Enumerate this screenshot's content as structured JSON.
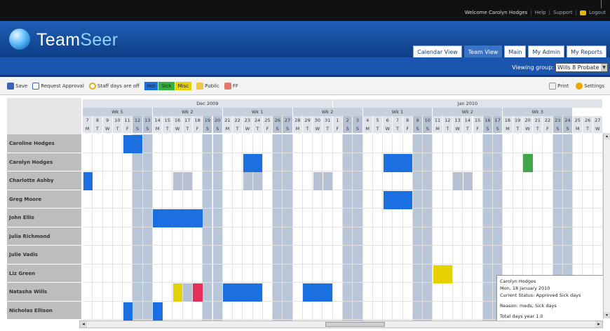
{
  "topbar": {
    "welcome": "Welcome Carolyn Hodges",
    "help": "Help",
    "support": "Support",
    "logout": "Logout",
    "sep": "|"
  },
  "header": {
    "logo_team": "Team",
    "logo_seer": "Seer",
    "tabs": [
      {
        "label": "Calendar View",
        "active": false
      },
      {
        "label": "Team View",
        "active": true
      },
      {
        "label": "Main",
        "active": false
      },
      {
        "label": "My Admin",
        "active": false
      },
      {
        "label": "My Reports",
        "active": false
      }
    ]
  },
  "group": {
    "label": "Viewing group:",
    "value": "Wills 8 Probate"
  },
  "toolbar": {
    "save": "Save",
    "request": "Request Approval",
    "staff": "Staff days are off",
    "legend": [
      {
        "label": "Hol",
        "color": "#1b6fe0"
      },
      {
        "label": "Sick",
        "color": "#36b140"
      },
      {
        "label": "Misc",
        "color": "#e5d000"
      }
    ],
    "public": "Public",
    "ff": "FF",
    "print": "Print",
    "settings": "Settings"
  },
  "calendar": {
    "months": [
      {
        "label": "Dec 2009"
      },
      {
        "label": "Jan 2010"
      }
    ],
    "weeks": [
      "Wk 5",
      "Wk 2",
      "Wk 1",
      "Wk 2",
      "Wk 1",
      "Wk 2",
      "Wk 3"
    ],
    "dates": [
      "7",
      "8",
      "9",
      "10",
      "11",
      "12",
      "13",
      "14",
      "15",
      "16",
      "17",
      "18",
      "19",
      "20",
      "21",
      "22",
      "23",
      "24",
      "25",
      "26",
      "27",
      "28",
      "29",
      "30",
      "31",
      "1",
      "2",
      "3",
      "4",
      "5",
      "6",
      "7",
      "8",
      "9",
      "10",
      "11",
      "12",
      "13",
      "14",
      "15",
      "16",
      "17",
      "18",
      "19",
      "20",
      "21",
      "22",
      "23",
      "24",
      "25",
      "26",
      "27"
    ],
    "days": [
      "M",
      "T",
      "W",
      "T",
      "F",
      "S",
      "S",
      "M",
      "T",
      "W",
      "T",
      "F",
      "S",
      "S",
      "M",
      "T",
      "W",
      "T",
      "F",
      "S",
      "S",
      "M",
      "T",
      "W",
      "T",
      "F",
      "S",
      "S",
      "M",
      "T",
      "W",
      "T",
      "F",
      "S",
      "S",
      "M",
      "T",
      "W",
      "T",
      "F",
      "S",
      "S",
      "M",
      "T",
      "W",
      "T",
      "F",
      "S",
      "S",
      "M",
      "T",
      "W"
    ],
    "people": [
      "Caroline Hodges",
      "Carolyn Hodges",
      "Charlotte Ashby",
      "Greg Moore",
      "John Ellis",
      "Julia Richmond",
      "Julie Vadis",
      "Liz Green",
      "Natasha Wills",
      "Nicholas Ellison"
    ],
    "events": [
      {
        "row": 0,
        "start": 4,
        "span": 2,
        "color": "#1b6fe0"
      },
      {
        "row": 1,
        "start": 16,
        "span": 2,
        "color": "#1b6fe0"
      },
      {
        "row": 1,
        "start": 30,
        "span": 3,
        "color": "#1b6fe0"
      },
      {
        "row": 1,
        "start": 44,
        "span": 1,
        "color": "#3fa64a"
      },
      {
        "row": 2,
        "start": 0,
        "span": 1,
        "color": "#1b6fe0"
      },
      {
        "row": 2,
        "start": 9,
        "span": 1,
        "color": "#b6c2d3"
      },
      {
        "row": 2,
        "start": 10,
        "span": 1,
        "color": "#b6c2d3"
      },
      {
        "row": 2,
        "start": 16,
        "span": 1,
        "color": "#b6c2d3"
      },
      {
        "row": 2,
        "start": 17,
        "span": 1,
        "color": "#b6c2d3"
      },
      {
        "row": 2,
        "start": 23,
        "span": 1,
        "color": "#b6c2d3"
      },
      {
        "row": 2,
        "start": 24,
        "span": 1,
        "color": "#b6c2d3"
      },
      {
        "row": 2,
        "start": 37,
        "span": 1,
        "color": "#b6c2d3"
      },
      {
        "row": 2,
        "start": 38,
        "span": 1,
        "color": "#b6c2d3"
      },
      {
        "row": 3,
        "start": 30,
        "span": 3,
        "color": "#1b6fe0"
      },
      {
        "row": 4,
        "start": 7,
        "span": 5,
        "color": "#1b6fe0"
      },
      {
        "row": 7,
        "start": 35,
        "span": 2,
        "color": "#e5d000"
      },
      {
        "row": 8,
        "start": 9,
        "span": 1,
        "color": "#e5d000"
      },
      {
        "row": 8,
        "start": 10,
        "span": 1,
        "color": "#b6c2d3"
      },
      {
        "row": 8,
        "start": 11,
        "span": 1,
        "color": "#e62e5a"
      },
      {
        "row": 8,
        "start": 14,
        "span": 4,
        "color": "#1b6fe0"
      },
      {
        "row": 8,
        "start": 22,
        "span": 3,
        "color": "#1b6fe0"
      },
      {
        "row": 9,
        "start": 4,
        "span": 1,
        "color": "#1b6fe0"
      },
      {
        "row": 9,
        "start": 7,
        "span": 1,
        "color": "#1b6fe0"
      }
    ]
  },
  "popup": {
    "line1": "Carolyn Hodges",
    "line2": "Mon, 18 January 2010",
    "line3": "Current Status: Approved Sick days",
    "line4": "Reason: meds; Sick days",
    "line5": "Total days year 1.0"
  },
  "scroll": {
    "left": "◂",
    "right": "▸",
    "up": "▴",
    "down": "▾"
  }
}
